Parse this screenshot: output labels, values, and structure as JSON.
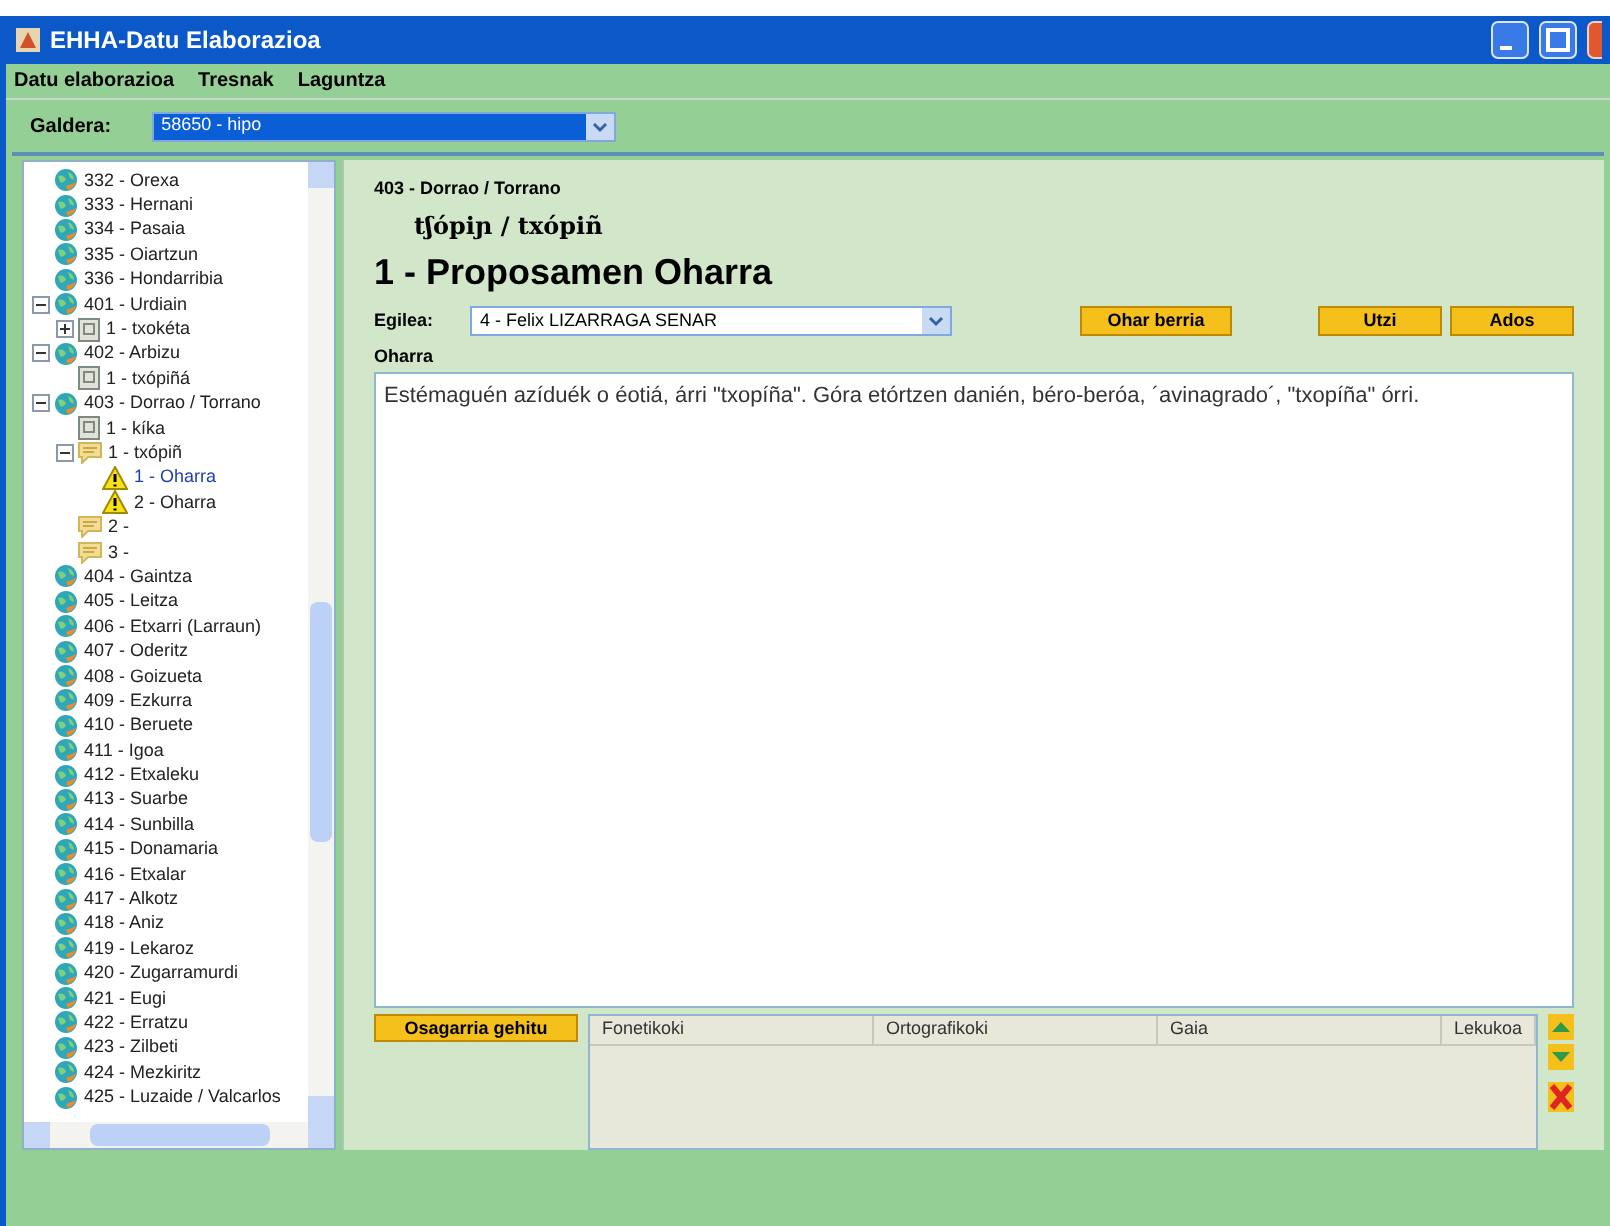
{
  "window": {
    "title": "EHHA-Datu Elaborazioa"
  },
  "menu": [
    "Datu elaborazioa",
    "Tresnak",
    "Laguntza"
  ],
  "question": {
    "label": "Galdera:",
    "value": "58650 - hipo"
  },
  "tree": [
    {
      "kind": "place",
      "label": "332 - Orexa"
    },
    {
      "kind": "place",
      "label": "333 - Hernani"
    },
    {
      "kind": "place",
      "label": "334 - Pasaia"
    },
    {
      "kind": "place",
      "label": "335 - Oiartzun"
    },
    {
      "kind": "place",
      "label": "336 - Hondarribia"
    },
    {
      "kind": "place",
      "label": "401 - Urdiain",
      "expanded": true,
      "children": [
        {
          "kind": "document",
          "label": "1 - txokéta",
          "expanded": false
        }
      ]
    },
    {
      "kind": "place",
      "label": "402 - Arbizu",
      "expanded": true,
      "children": [
        {
          "kind": "document",
          "label": "1 - txópiñá"
        }
      ]
    },
    {
      "kind": "place",
      "label": "403 - Dorrao / Torrano",
      "expanded": true,
      "children": [
        {
          "kind": "document",
          "label": "1 - kíka"
        },
        {
          "kind": "comment",
          "label": "1 - txópiñ",
          "expanded": true,
          "children": [
            {
              "kind": "warning",
              "label": "1 - Oharra",
              "selected": true
            },
            {
              "kind": "warning",
              "label": "2 - Oharra",
              "selected": false
            }
          ]
        },
        {
          "kind": "comment",
          "label": "2 -"
        },
        {
          "kind": "comment",
          "label": "3 -"
        }
      ]
    },
    {
      "kind": "place",
      "label": "404 - Gaintza"
    },
    {
      "kind": "place",
      "label": "405 - Leitza"
    },
    {
      "kind": "place",
      "label": "406 - Etxarri (Larraun)"
    },
    {
      "kind": "place",
      "label": "407 - Oderitz"
    },
    {
      "kind": "place",
      "label": "408 - Goizueta"
    },
    {
      "kind": "place",
      "label": "409 - Ezkurra"
    },
    {
      "kind": "place",
      "label": "410 - Beruete"
    },
    {
      "kind": "place",
      "label": "411 - Igoa"
    },
    {
      "kind": "place",
      "label": "412 - Etxaleku"
    },
    {
      "kind": "place",
      "label": "413 - Suarbe"
    },
    {
      "kind": "place",
      "label": "414 - Sunbilla"
    },
    {
      "kind": "place",
      "label": "415 - Donamaria"
    },
    {
      "kind": "place",
      "label": "416 - Etxalar"
    },
    {
      "kind": "place",
      "label": "417 - Alkotz"
    },
    {
      "kind": "place",
      "label": "418 - Aniz"
    },
    {
      "kind": "place",
      "label": "419 - Lekaroz"
    },
    {
      "kind": "place",
      "label": "420 - Zugarramurdi"
    },
    {
      "kind": "place",
      "label": "421 - Eugi"
    },
    {
      "kind": "place",
      "label": "422 - Erratzu"
    },
    {
      "kind": "place",
      "label": "423 - Zilbeti"
    },
    {
      "kind": "place",
      "label": "424 - Mezkiritz"
    },
    {
      "kind": "place",
      "label": "425 - Luzaide / Valcarlos"
    }
  ],
  "detail": {
    "place": "403 - Dorrao / Torrano",
    "transcription": "tʃópiɲ / txópiñ",
    "title": "1 - Proposamen Oharra",
    "author": {
      "label": "Egilea:",
      "value": "4 - Felix LIZARRAGA SENAR"
    },
    "buttons": [
      "Ohar berria",
      "Utzi",
      "Ados"
    ],
    "note": {
      "label": "Oharra",
      "value": "Estémaguén azíduék o éotiá, árri \"txopíña\". Góra etórtzen danién, béro-beróa, ´avinagrado´, \"txopíña\" órri."
    },
    "add_button": "Osagarria gehitu",
    "table": {
      "columns": [
        "Fonetikoki",
        "Ortografikoki",
        "Gaia",
        "Lekukoa"
      ]
    }
  }
}
